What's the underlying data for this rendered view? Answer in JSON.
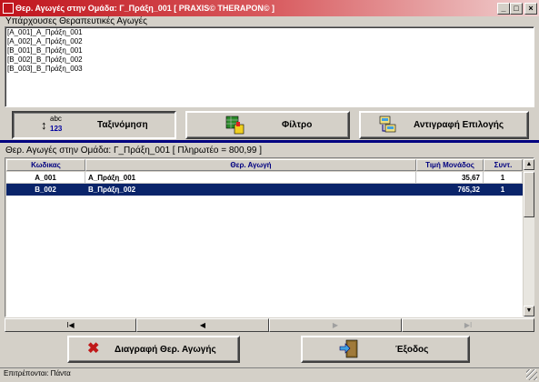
{
  "window": {
    "title": "Θερ. Αγωγές στην Ομάδα: Γ_Πράξη_001 [ PRAXIS© THERAPON© ]",
    "minimize_glyph": "_",
    "maximize_glyph": "□",
    "close_glyph": "×"
  },
  "existing": {
    "label": "Υπάρχουσες Θεραπευτικές Αγωγές",
    "items": [
      "[A_001]_A_Πράξη_001",
      "[A_002]_A_Πράξη_002",
      "[B_001]_B_Πράξη_001",
      "[B_002]_B_Πράξη_002",
      "[B_003]_B_Πράξη_003"
    ]
  },
  "toolbar": {
    "sort_label": "Ταξινόμηση",
    "sort_icon_top": "abc",
    "sort_icon_bottom": "123",
    "filter_label": "Φίλτρο",
    "copy_label": "Αντιγραφή Επιλογής"
  },
  "group": {
    "label": "Θερ. Αγωγές στην Ομάδα: Γ_Πράξη_001 [ Πληρωτέο = 800,99 ]"
  },
  "grid": {
    "headers": {
      "code": "Κωδικας",
      "therapy": "Θερ. Αγωγή",
      "price": "Τιμή Μονάδος",
      "coef": "Συντ."
    },
    "rows": [
      {
        "code": "A_001",
        "therapy": "A_Πράξη_001",
        "price": "35,67",
        "coef": "1",
        "selected": false
      },
      {
        "code": "B_002",
        "therapy": "B_Πράξη_002",
        "price": "765,32",
        "coef": "1",
        "selected": true
      }
    ]
  },
  "nav": {
    "first": "I◀",
    "prev": "◀",
    "next": "▶",
    "last": "▶I"
  },
  "actions": {
    "delete_label": "Διαγραφή Θερ. Αγωγής",
    "exit_label": "Έξοδος"
  },
  "status": {
    "text": "Επιτρέπονται: Πάντα"
  },
  "colors": {
    "title_start": "#c0141c",
    "selection": "#0a246a",
    "header_text": "#000080",
    "divider": "#000080"
  }
}
